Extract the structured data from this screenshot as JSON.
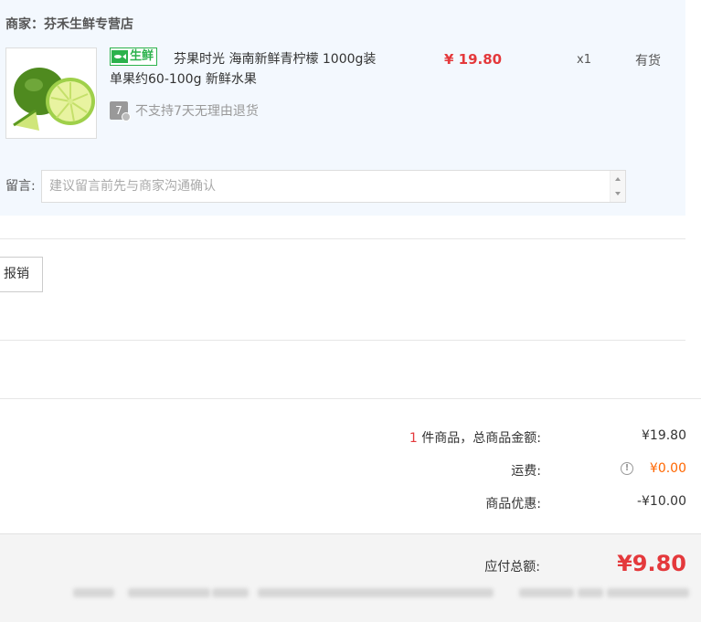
{
  "merchant": {
    "title": "商家：芬禾生鲜专营店"
  },
  "product": {
    "tag": "生鲜",
    "name": "芬果时光 海南新鲜青柠檬 1000g装 单果约60-100g 新鲜水果",
    "price": "¥ 19.80",
    "qty": "x1",
    "stock": "有货",
    "return_icon_text": "7",
    "return_policy": "不支持7天无理由退货",
    "image": "lime-fruit-image"
  },
  "memo": {
    "label": "留言:",
    "placeholder": "建议留言前先与商家沟通确认"
  },
  "reimburse": {
    "label": "报销"
  },
  "summary": {
    "count": "1",
    "count_suffix": " 件商品，总商品金额:",
    "subtotal": "¥19.80",
    "shipping_label": "运费:",
    "shipping": "¥0.00",
    "discount_label": "商品优惠:",
    "discount": "-¥10.00"
  },
  "total": {
    "label": "应付总额:",
    "value": "¥9.80"
  },
  "colors": {
    "accent_red": "#e4393c",
    "shipping_orange": "#f60",
    "fresh_green": "#2bb24c",
    "panel_bg": "#f3f8fe"
  }
}
